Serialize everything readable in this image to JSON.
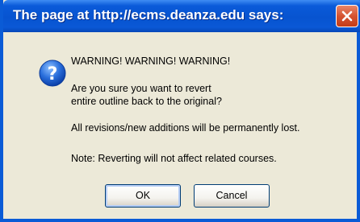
{
  "window": {
    "title": "The page at http://ecms.deanza.edu says:"
  },
  "dialog": {
    "icon": "question-icon",
    "lines": [
      "WARNING! WARNING! WARNING!",
      "Are you sure you want to revert",
      "entire outline back to the original?",
      "All revisions/new additions will be permanently lost.",
      "Note: Reverting will not affect related courses."
    ]
  },
  "buttons": {
    "ok_label": "OK",
    "cancel_label": "Cancel"
  },
  "colors": {
    "titlebar": "#0754d0",
    "dialog_bg": "#ece9d8",
    "close_button": "#d55331",
    "icon_blue": "#2a6fdc"
  }
}
